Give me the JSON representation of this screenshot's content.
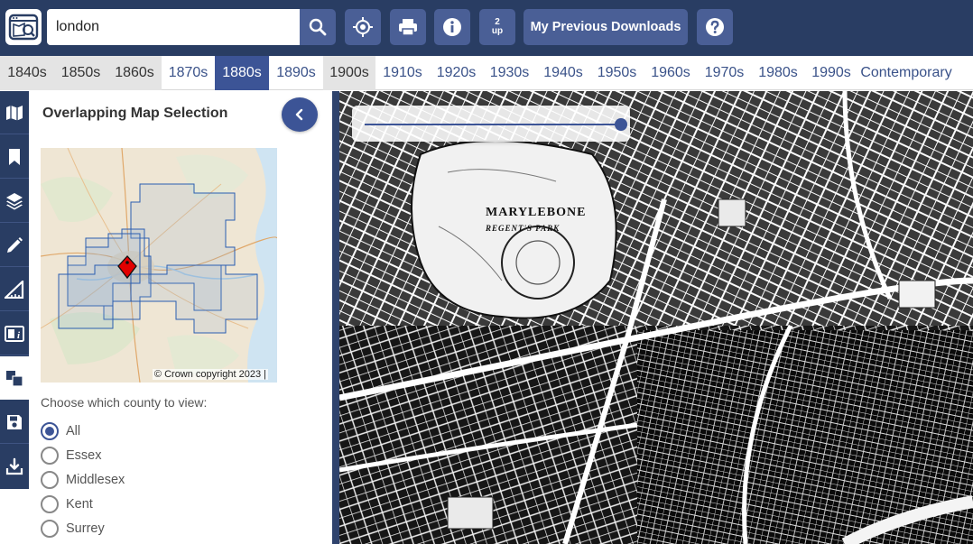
{
  "search": {
    "value": "london"
  },
  "toolbar": {
    "two_up_line1": "2",
    "two_up_line2": "up",
    "downloads_label": "My Previous Downloads"
  },
  "decades": [
    {
      "label": "1840s",
      "state": "gray"
    },
    {
      "label": "1850s",
      "state": "gray"
    },
    {
      "label": "1860s",
      "state": "gray"
    },
    {
      "label": "1870s",
      "state": "normal"
    },
    {
      "label": "1880s",
      "state": "active"
    },
    {
      "label": "1890s",
      "state": "normal"
    },
    {
      "label": "1900s",
      "state": "gray"
    },
    {
      "label": "1910s",
      "state": "normal"
    },
    {
      "label": "1920s",
      "state": "normal"
    },
    {
      "label": "1930s",
      "state": "normal"
    },
    {
      "label": "1940s",
      "state": "normal"
    },
    {
      "label": "1950s",
      "state": "normal"
    },
    {
      "label": "1960s",
      "state": "normal"
    },
    {
      "label": "1970s",
      "state": "normal"
    },
    {
      "label": "1980s",
      "state": "normal"
    },
    {
      "label": "1990s",
      "state": "normal"
    },
    {
      "label": "Contemporary",
      "state": "normal"
    }
  ],
  "sidebar_tools": [
    "map-icon",
    "bookmark-icon",
    "layers-icon",
    "pencil-icon",
    "ruler-icon",
    "info-panel-icon",
    "overlap-icon",
    "save-icon",
    "download-icon"
  ],
  "panel": {
    "title": "Overlapping Map Selection",
    "copyright": "© Crown copyright 2023 |",
    "choose_label": "Choose which county to view:",
    "counties": [
      {
        "label": "All",
        "checked": true
      },
      {
        "label": "Essex",
        "checked": false
      },
      {
        "label": "Middlesex",
        "checked": false
      },
      {
        "label": "Kent",
        "checked": false
      },
      {
        "label": "Surrey",
        "checked": false
      }
    ]
  },
  "map": {
    "opacity_value": 100,
    "place_label": "MARYLEBONE",
    "place_sublabel": "REGENT'S PARK"
  },
  "colors": {
    "header": "#293d63",
    "button": "#4a5f96",
    "accent": "#3c5496"
  }
}
